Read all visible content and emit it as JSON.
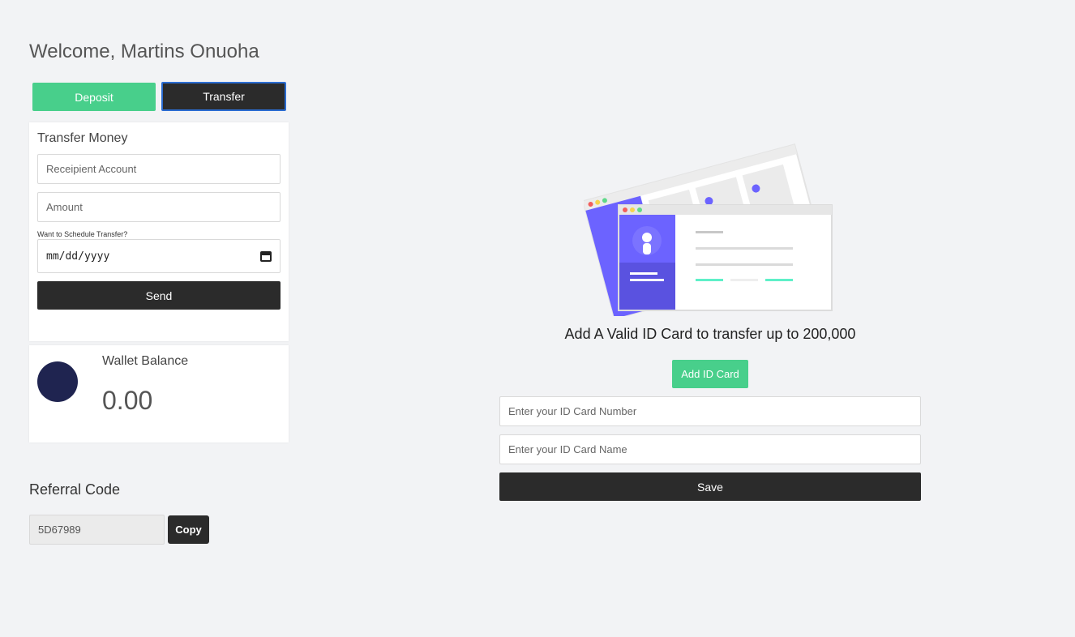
{
  "header": {
    "welcome": "Welcome, Martins Onuoha"
  },
  "tabs": {
    "deposit_label": "Deposit",
    "transfer_label": "Transfer"
  },
  "transfer_form": {
    "title": "Transfer Money",
    "recipient_placeholder": "Receipient Account",
    "amount_placeholder": "Amount",
    "schedule_label": "Want to Schedule Transfer?",
    "date_placeholder": "mm/dd/yyyy",
    "send_label": "Send"
  },
  "wallet": {
    "label": "Wallet Balance",
    "amount": "0.00"
  },
  "referral": {
    "title": "Referral Code",
    "code": "5D67989",
    "copy_label": "Copy"
  },
  "id_card": {
    "heading": "Add A Valid ID Card to transfer up to 200,000",
    "add_label": "Add ID Card",
    "number_placeholder": "Enter your ID Card Number",
    "name_placeholder": "Enter your ID Card Name",
    "save_label": "Save"
  },
  "colors": {
    "accent_green": "#48cf8b",
    "dark": "#2b2b2b",
    "illustration_purple": "#6c63ff",
    "avatar_navy": "#1f2450"
  },
  "icons": {
    "date_picker": "calendar-icon",
    "illustration": "id-card-illustration"
  }
}
